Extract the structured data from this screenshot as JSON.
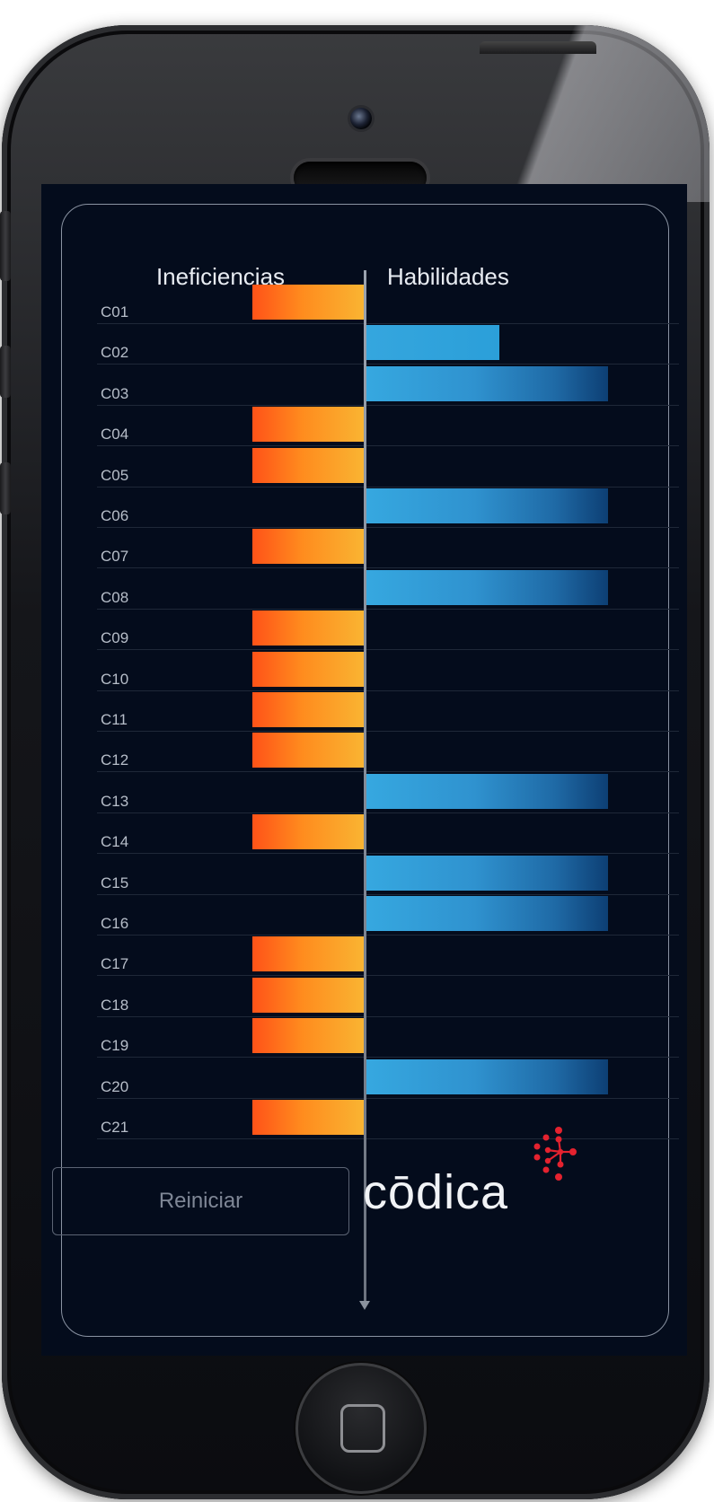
{
  "app": {
    "headers": {
      "left": "Ineficiencias",
      "right": "Habilidades"
    },
    "reset_label": "Reiniciar",
    "brand": "cōdica",
    "colors": {
      "background": "#040c1c",
      "inefficiency": "#ff6a1a",
      "skill": "#2f9fd9",
      "logo_accent": "#e4222f"
    }
  },
  "chart_data": {
    "type": "bar",
    "orientation": "horizontal-diverging",
    "series": [
      {
        "name": "Ineficiencias",
        "values": [
          1,
          0,
          0,
          1,
          1,
          0,
          1,
          0,
          1,
          1,
          1,
          1,
          0,
          1,
          0,
          0,
          1,
          1,
          1,
          0,
          1
        ]
      },
      {
        "name": "Habilidades",
        "values": [
          0,
          0.55,
          1,
          0,
          0,
          1,
          0,
          1,
          0,
          0,
          0,
          0,
          1,
          0,
          1,
          1,
          0,
          0,
          0,
          1,
          0
        ]
      }
    ],
    "categories": [
      "C01",
      "C02",
      "C03",
      "C04",
      "C05",
      "C06",
      "C07",
      "C08",
      "C09",
      "C10",
      "C11",
      "C12",
      "C13",
      "C14",
      "C15",
      "C16",
      "C17",
      "C18",
      "C19",
      "C20",
      "C21"
    ]
  }
}
